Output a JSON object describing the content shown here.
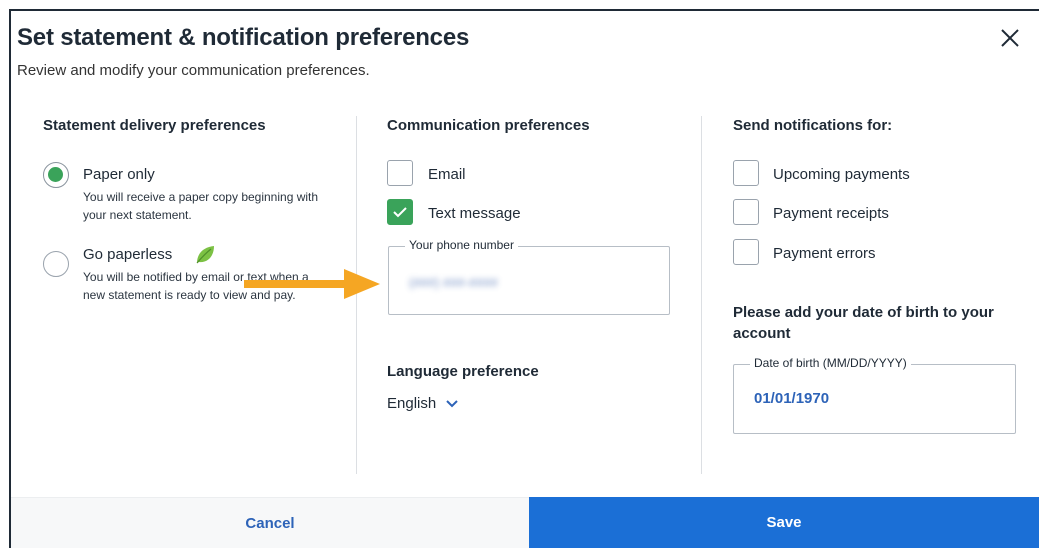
{
  "dialog": {
    "title": "Set statement & notification preferences",
    "subtitle": "Review and modify your communication preferences."
  },
  "statement": {
    "heading": "Statement delivery preferences",
    "options": [
      {
        "label": "Paper only",
        "description": "You will receive a paper copy beginning with your next statement.",
        "selected": true
      },
      {
        "label": "Go paperless",
        "description": "You will be notified by email or text when a new statement is ready to view and pay.",
        "selected": false,
        "icon": "leaf-icon"
      }
    ]
  },
  "communication": {
    "heading": "Communication preferences",
    "options": [
      {
        "label": "Email",
        "checked": false
      },
      {
        "label": "Text message",
        "checked": true
      }
    ],
    "phone": {
      "label": "Your phone number",
      "value": "(###) ###-####"
    },
    "language": {
      "label": "Language preference",
      "value": "English",
      "icon": "chevron-down-icon"
    }
  },
  "notifications": {
    "heading": "Send notifications for:",
    "options": [
      {
        "label": "Upcoming payments",
        "checked": false
      },
      {
        "label": "Payment receipts",
        "checked": false
      },
      {
        "label": "Payment errors",
        "checked": false
      }
    ],
    "dob": {
      "heading": "Please add your date of birth to your account",
      "label": "Date of birth (MM/DD/YYYY)",
      "value": "01/01/1970"
    }
  },
  "footer": {
    "cancel_label": "Cancel",
    "save_label": "Save"
  },
  "colors": {
    "accent": "#1b6fd6",
    "success": "#3aa35a",
    "annotation_arrow": "#f5a623"
  }
}
